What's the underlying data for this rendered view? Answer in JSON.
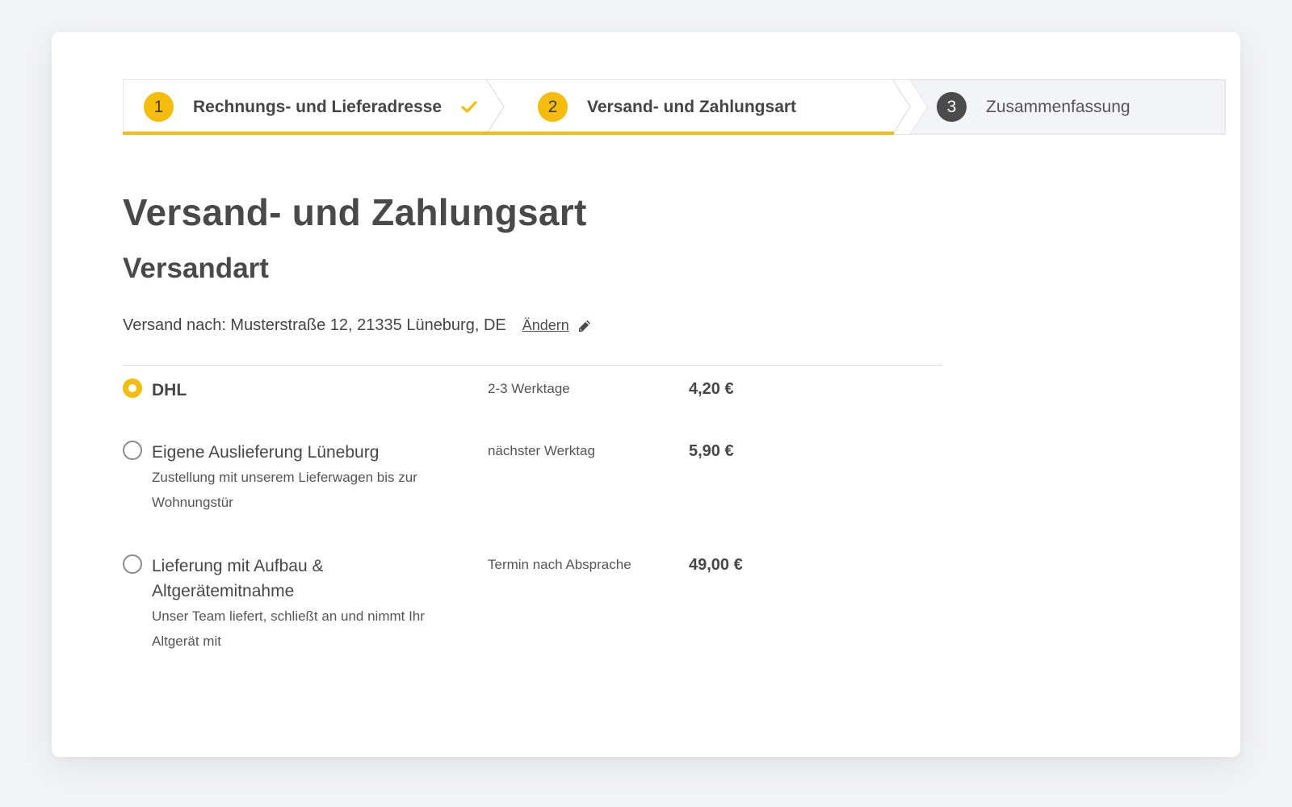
{
  "colors": {
    "accent": "#f5bd0a",
    "text": "#4a4a4a",
    "inactive_badge": "#4b4b4b",
    "page_bg": "#f2f3f6"
  },
  "stepper": {
    "steps": [
      {
        "number": "1",
        "label": "Rechnungs- und Lieferadresse",
        "state": "done",
        "icon": "check-icon"
      },
      {
        "number": "2",
        "label": "Versand- und Zahlungsart",
        "state": "current"
      },
      {
        "number": "3",
        "label": "Zusammenfassung",
        "state": "upcoming"
      }
    ]
  },
  "page": {
    "title": "Versand- und Zahlungsart",
    "section_title": "Versandart",
    "address_label": "Versand nach: Musterstraße 12, 21335 Lüneburg, DE",
    "change_link": "Ändern",
    "change_icon": "pencil-icon"
  },
  "shipping_options": [
    {
      "name": "DHL",
      "description": "",
      "delivery_time": "2-3 Werktage",
      "price": "4,20 €",
      "selected": true
    },
    {
      "name": "Eigene Auslieferung Lüneburg",
      "description": "Zustellung mit unserem Lieferwagen bis zur Wohnungstür",
      "delivery_time": "nächster Werktag",
      "price": "5,90 €",
      "selected": false
    },
    {
      "name": "Lieferung mit Aufbau & Altgerätemitnahme",
      "description": "Unser Team liefert, schließt an und nimmt Ihr Altgerät mit",
      "delivery_time": "Termin nach Absprache",
      "price": "49,00 €",
      "selected": false
    }
  ]
}
